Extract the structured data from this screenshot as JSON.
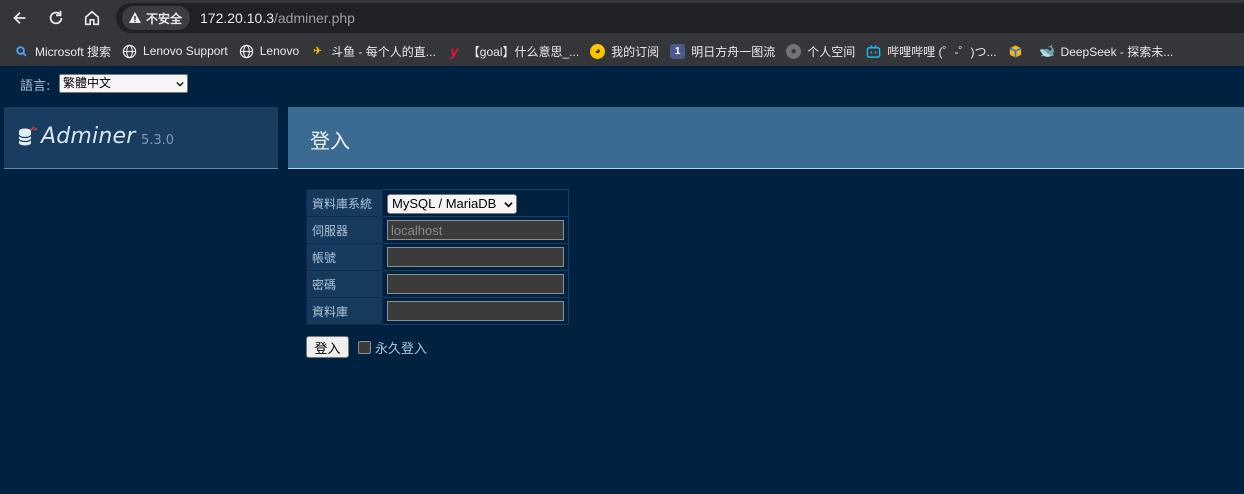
{
  "browser": {
    "security_label": "不安全",
    "url_host": "172.20.10.3",
    "url_path": "/adminer.php",
    "bookmarks": [
      {
        "label": "Microsoft 搜索",
        "icon": "search-icon"
      },
      {
        "label": "Lenovo Support",
        "icon": "globe-icon"
      },
      {
        "label": "Lenovo",
        "icon": "globe-icon"
      },
      {
        "label": "斗鱼 - 每个人的直...",
        "icon": "douyu-icon"
      },
      {
        "label": "【goal】什么意思_...",
        "icon": "youdao-icon"
      },
      {
        "label": "我的订阅",
        "icon": "subscription-icon"
      },
      {
        "label": "明日方舟一图流",
        "icon": "number-one-icon"
      },
      {
        "label": "个人空间",
        "icon": "gray-globe-icon"
      },
      {
        "label": "哔哩哔哩 (゜-゜)つ...",
        "icon": "bilibili-icon"
      },
      {
        "label": "",
        "icon": "cube-icon"
      },
      {
        "label": "DeepSeek - 探索未...",
        "icon": "deepseek-icon"
      }
    ]
  },
  "language": {
    "label": "語言:",
    "selected": "繁體中文"
  },
  "app": {
    "name": "Adminer",
    "version": "5.3.0"
  },
  "login": {
    "title": "登入",
    "fields": {
      "system_label": "資料庫系統",
      "system_value": "MySQL / MariaDB",
      "server_label": "伺服器",
      "server_placeholder": "localhost",
      "username_label": "帳號",
      "password_label": "密碼",
      "database_label": "資料庫"
    },
    "submit_label": "登入",
    "permanent_label": "永久登入"
  },
  "colors": {
    "page_bg": "#002240",
    "header_bg": "#3b6a91",
    "menu_bg": "#183d60"
  }
}
